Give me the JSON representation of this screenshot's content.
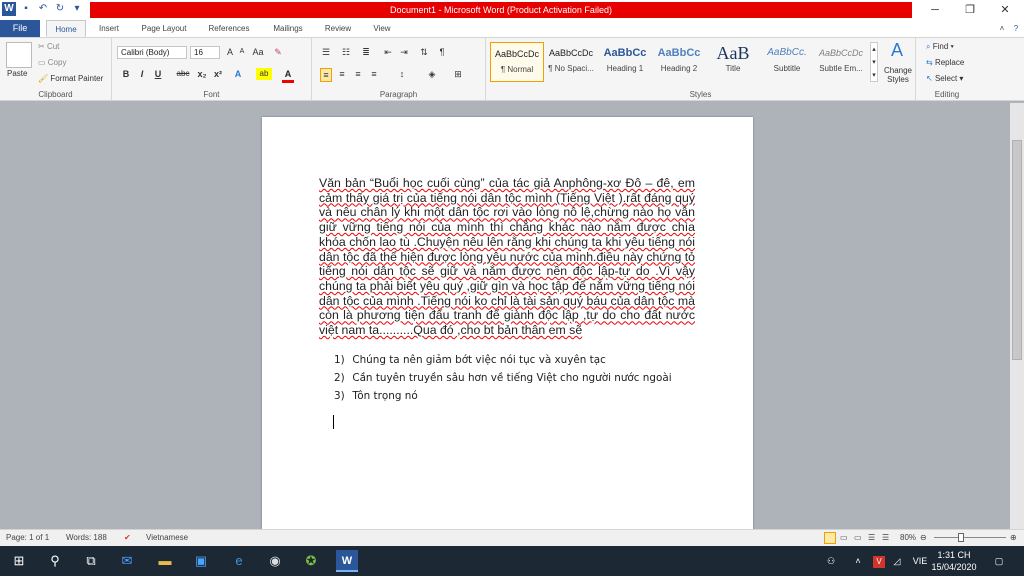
{
  "titlebar": {
    "title": "Document1  -  Microsoft Word (Product Activation Failed)",
    "minimize": "─",
    "maximize": "❐",
    "close": "✕"
  },
  "qat": {
    "logo": "W",
    "save": "💾",
    "undo": "↶",
    "redo": "↻"
  },
  "tabs": {
    "file": "File",
    "items": [
      "Home",
      "Insert",
      "Page Layout",
      "References",
      "Mailings",
      "Review",
      "View"
    ]
  },
  "ribbon": {
    "clipboard": {
      "label": "Clipboard",
      "paste": "Paste",
      "cut": "Cut",
      "copy": "Copy",
      "format_painter": "Format Painter"
    },
    "font": {
      "label": "Font",
      "family": "Calibri (Body)",
      "size": "16",
      "grow": "A˄",
      "shrink": "A˅",
      "case": "Aa",
      "clear": "✎",
      "bold": "B",
      "italic": "I",
      "underline": "U",
      "strike": "abc",
      "sub": "x₂",
      "sup": "x²",
      "effects": "A",
      "highlight": "ab",
      "color": "A"
    },
    "paragraph": {
      "label": "Paragraph"
    },
    "styles": {
      "label": "Styles",
      "items": [
        {
          "preview": "AaBbCcDc",
          "name": "¶ Normal"
        },
        {
          "preview": "AaBbCcDc",
          "name": "¶ No Spaci..."
        },
        {
          "preview": "AaBbCc",
          "name": "Heading 1"
        },
        {
          "preview": "AaBbCc",
          "name": "Heading 2"
        },
        {
          "preview": "AaB",
          "name": "Title"
        },
        {
          "preview": "AaBbCc.",
          "name": "Subtitle"
        },
        {
          "preview": "AaBbCcDc",
          "name": "Subtle Em..."
        }
      ],
      "change_styles": "Change Styles"
    },
    "editing": {
      "label": "Editing",
      "find": "Find",
      "replace": "Replace",
      "select": "Select"
    }
  },
  "document": {
    "paragraph": "Văn bản “Buổi học cuối cùng” của tác giả Anphông-xơ Đô – đê, em cảm thấy giá trị của tiếng nói dân tộc mình (Tiếng Việt ).rất đáng quý và nêu chân lý khi một dân tộc rơi vào lòng nô lệ,chừng nào họ vẫn giữ vững tiếng nói của mình thì chẳng khác nào nắm được chìa khóa chốn lao tù .Chuyện nêu lên rằng khi chúng ta khi yêu tiếng nói dân tộc đã thể hiện được lòng yêu nước của mình.điều này chứng tỏ tiếng nói dân tộc sẽ giữ và nắm được nền độc lập-tự do .Vì vậy chúng ta phải biết yêu quý ,giữ gìn và học tập để nắm vững tiếng nói dân tộc của mình .Tiếng nói ko chỉ là tài sản quý báu của dân tộc mà còn là phương tiện đấu tranh để giành độc lập ,tự do cho đất nước việt nam ta..........Qua đó ,cho bt bản thân em sẽ",
    "list": [
      {
        "num": "1)",
        "text": "Chúng ta nên giảm bớt việc nói tục và xuyên tạc"
      },
      {
        "num": "2)",
        "text": "Cần tuyên truyền sâu hơn về tiếng Việt cho người nước ngoài"
      },
      {
        "num": "3)",
        "text": "Tôn trọng nó"
      }
    ]
  },
  "statusbar": {
    "page": "Page: 1 of 1",
    "words": "Words: 188",
    "language": "Vietnamese",
    "zoom": "80%"
  },
  "taskbar": {
    "lang": "VIE",
    "time": "1:31 CH",
    "date": "15/04/2020"
  }
}
